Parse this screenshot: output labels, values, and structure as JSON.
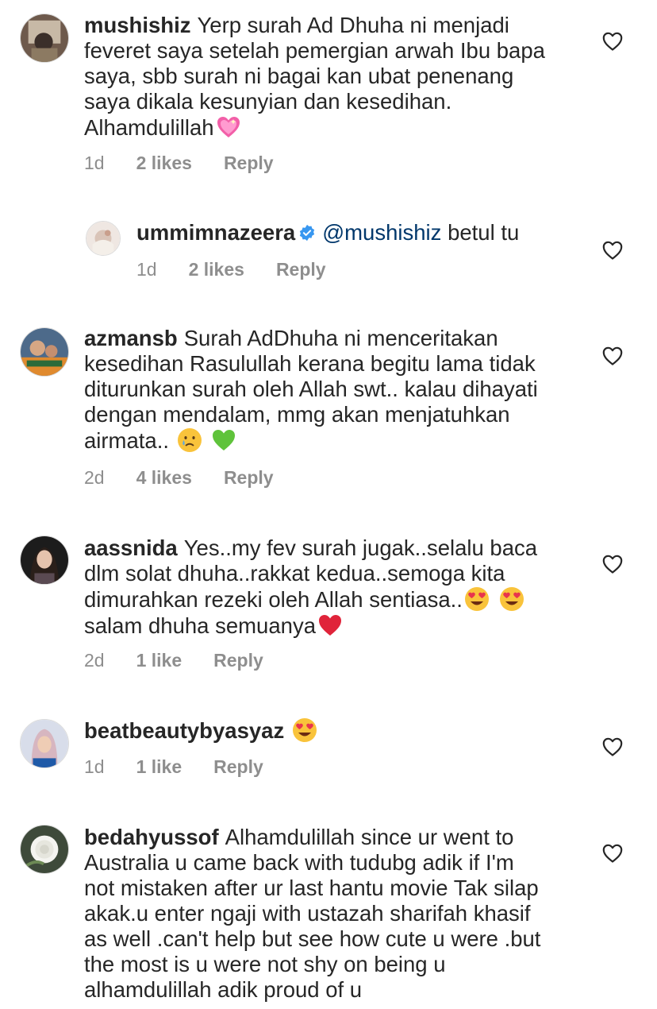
{
  "colors": {
    "text": "#262626",
    "meta": "#8e8e8e",
    "mention": "#00376b",
    "verified": "#3897f0"
  },
  "comments": [
    {
      "username": "mushishiz",
      "text": "Yerp surah Ad Dhuha ni menjadi\nfeveret saya setelah pemergian arwah Ibu bapa\nsaya, sbb surah ni bagai kan ubat penenang\nsaya dikala kesunyian dan kesedihan.\nAlhamdulillah",
      "time": "1d",
      "likes": "2 likes",
      "reply_label": "Reply",
      "emojis": [
        "sparkling-heart"
      ]
    },
    {
      "username": "ummimnazeera",
      "mention": "@mushishiz",
      "text": "betul tu",
      "time": "1d",
      "likes": "2 likes",
      "reply_label": "Reply",
      "verified": true
    },
    {
      "username": "azmansb",
      "text": "Surah AdDhuha ni menceritakan\nkesedihan Rasulullah kerana begitu lama tidak\nditurunkan surah oleh Allah swt.. kalau dihayati\ndengan mendalam, mmg akan menjatuhkan\nairmata..",
      "time": "2d",
      "likes": "4 likes",
      "reply_label": "Reply",
      "emojis": [
        "crying-face",
        "green-heart"
      ]
    },
    {
      "username": "aassnida",
      "text": "Yes..my fev surah jugak..selalu baca\ndlm solat dhuha..rakkat kedua..semoga kita\ndimurahkan rezeki oleh Allah sentiasa..",
      "text2": "salam dhuha semuanya",
      "time": "2d",
      "likes": "1 like",
      "reply_label": "Reply",
      "emojis": [
        "heart-eyes",
        "heart-eyes",
        "red-heart"
      ]
    },
    {
      "username": "beatbeautybyasyaz",
      "text": "",
      "time": "1d",
      "likes": "1 like",
      "reply_label": "Reply",
      "emojis": [
        "heart-eyes"
      ]
    },
    {
      "username": "bedahyussof",
      "text": "Alhamdulillah since ur went to\nAustralia u came back with tudubg adik if I'm\nnot mistaken after ur last hantu movie Tak silap\nakak.u enter ngaji with ustazah sharifah khasif\nas well .can't help but see how cute u were .but\nthe most is u were not shy on being u\nalhamdulillah adik proud of u",
      "emojis": []
    }
  ]
}
